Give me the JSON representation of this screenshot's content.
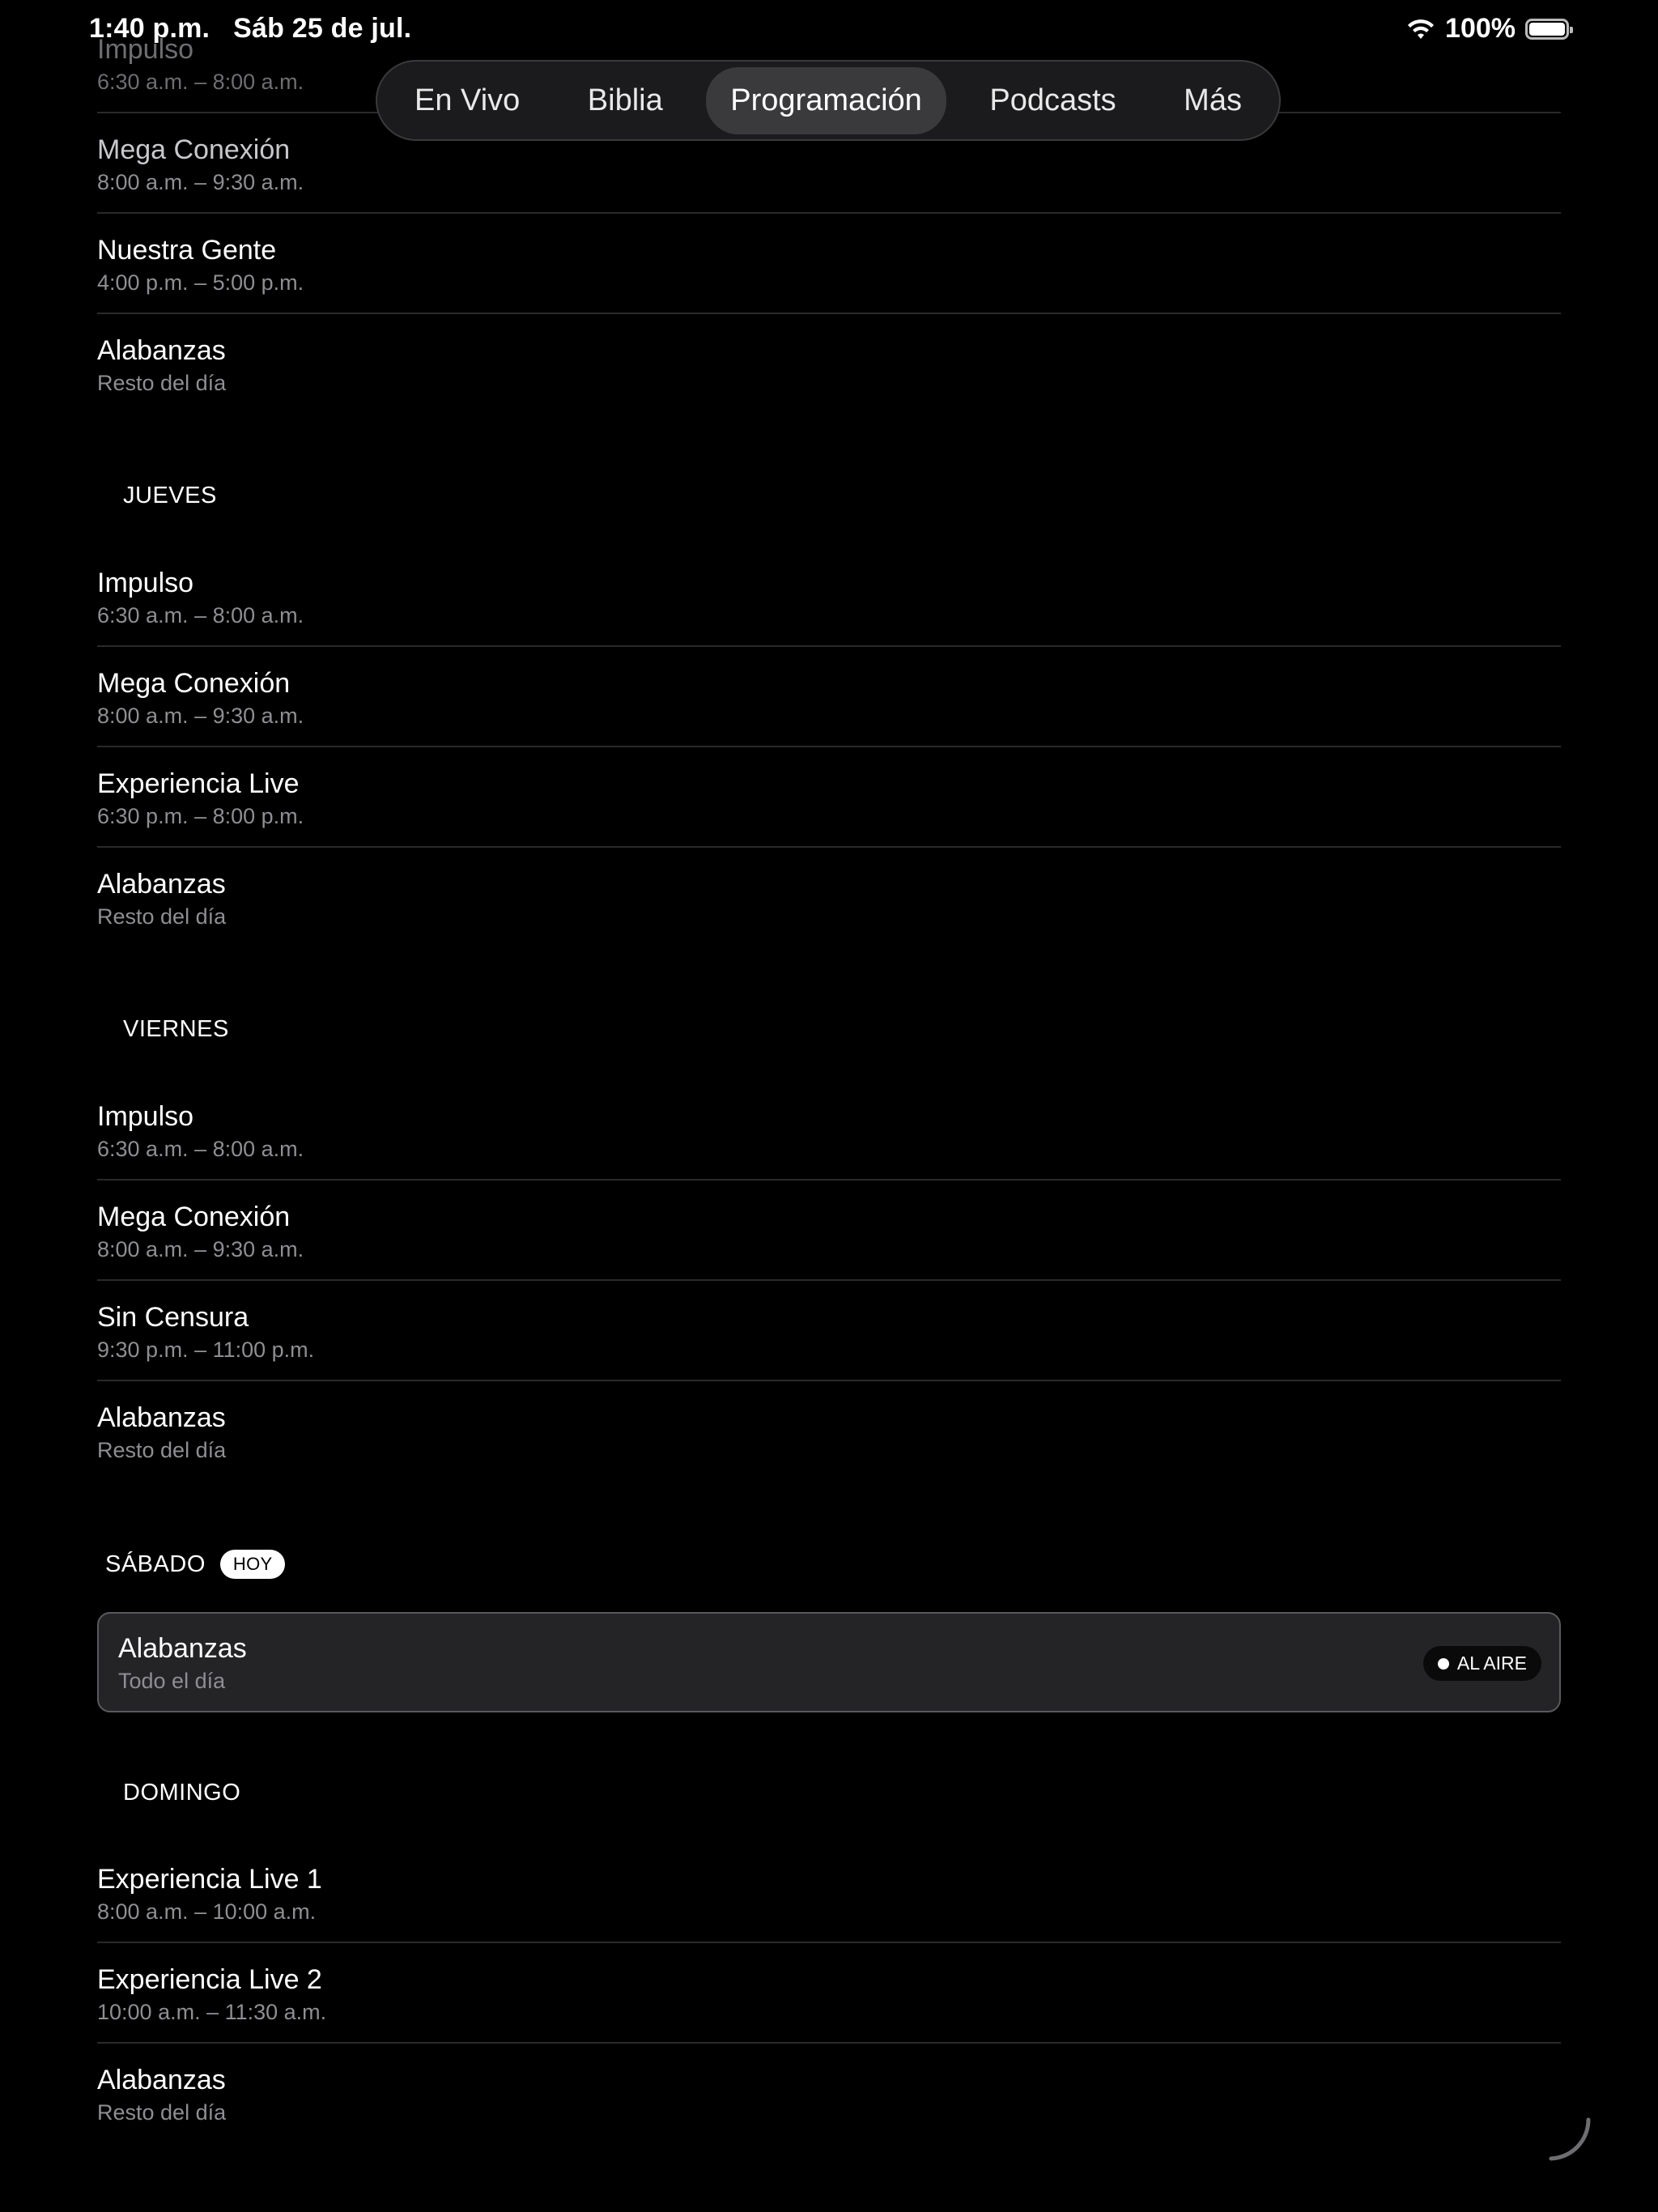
{
  "status_bar": {
    "time": "1:40 p.m.",
    "date": "Sáb 25 de jul.",
    "battery": "100%",
    "battery_level": 1.0,
    "wifi_icon": "wifi-icon"
  },
  "tabs": [
    {
      "label": "En Vivo",
      "active": false
    },
    {
      "label": "Biblia",
      "active": false
    },
    {
      "label": "Programación",
      "active": true
    },
    {
      "label": "Podcasts",
      "active": false
    },
    {
      "label": "Más",
      "active": false
    }
  ],
  "top_rows": [
    {
      "title": "Impulso",
      "time": "6:30 a.m. – 8:00 a.m."
    },
    {
      "title": "Mega Conexión",
      "time": "8:00 a.m. – 9:30 a.m."
    },
    {
      "title": "Nuestra Gente",
      "time": "4:00 p.m. – 5:00 p.m."
    },
    {
      "title": "Alabanzas",
      "time": "Resto del día"
    }
  ],
  "jueves": {
    "header": "JUEVES",
    "rows": [
      {
        "title": "Impulso",
        "time": "6:30 a.m. – 8:00 a.m."
      },
      {
        "title": "Mega Conexión",
        "time": "8:00 a.m. – 9:30 a.m."
      },
      {
        "title": "Experiencia Live",
        "time": "6:30 p.m. – 8:00 p.m."
      },
      {
        "title": "Alabanzas",
        "time": "Resto del día"
      }
    ]
  },
  "viernes": {
    "header": "VIERNES",
    "rows": [
      {
        "title": "Impulso",
        "time": "6:30 a.m. – 8:00 a.m."
      },
      {
        "title": "Mega Conexión",
        "time": "8:00 a.m. – 9:30 a.m."
      },
      {
        "title": "Sin Censura",
        "time": "9:30 p.m. – 11:00 p.m."
      },
      {
        "title": "Alabanzas",
        "time": "Resto del día"
      }
    ]
  },
  "sabado": {
    "header": "SÁBADO",
    "today_badge": "HOY",
    "rows": [
      {
        "title": "Alabanzas",
        "time": "Todo el día",
        "live_badge": "AL AIRE"
      }
    ]
  },
  "domingo": {
    "header": "DOMINGO",
    "rows": [
      {
        "title": "Experiencia Live 1",
        "time": "8:00 a.m. – 10:00 a.m."
      },
      {
        "title": "Experiencia Live 2",
        "time": "10:00 a.m. – 11:30 a.m."
      },
      {
        "title": "Alabanzas",
        "time": "Resto del día"
      }
    ]
  },
  "colors": {
    "background": "#000000",
    "tab_active": "#3a3a3c",
    "secondary_text": "#8e8e93",
    "divider": "#2a2a2c"
  }
}
